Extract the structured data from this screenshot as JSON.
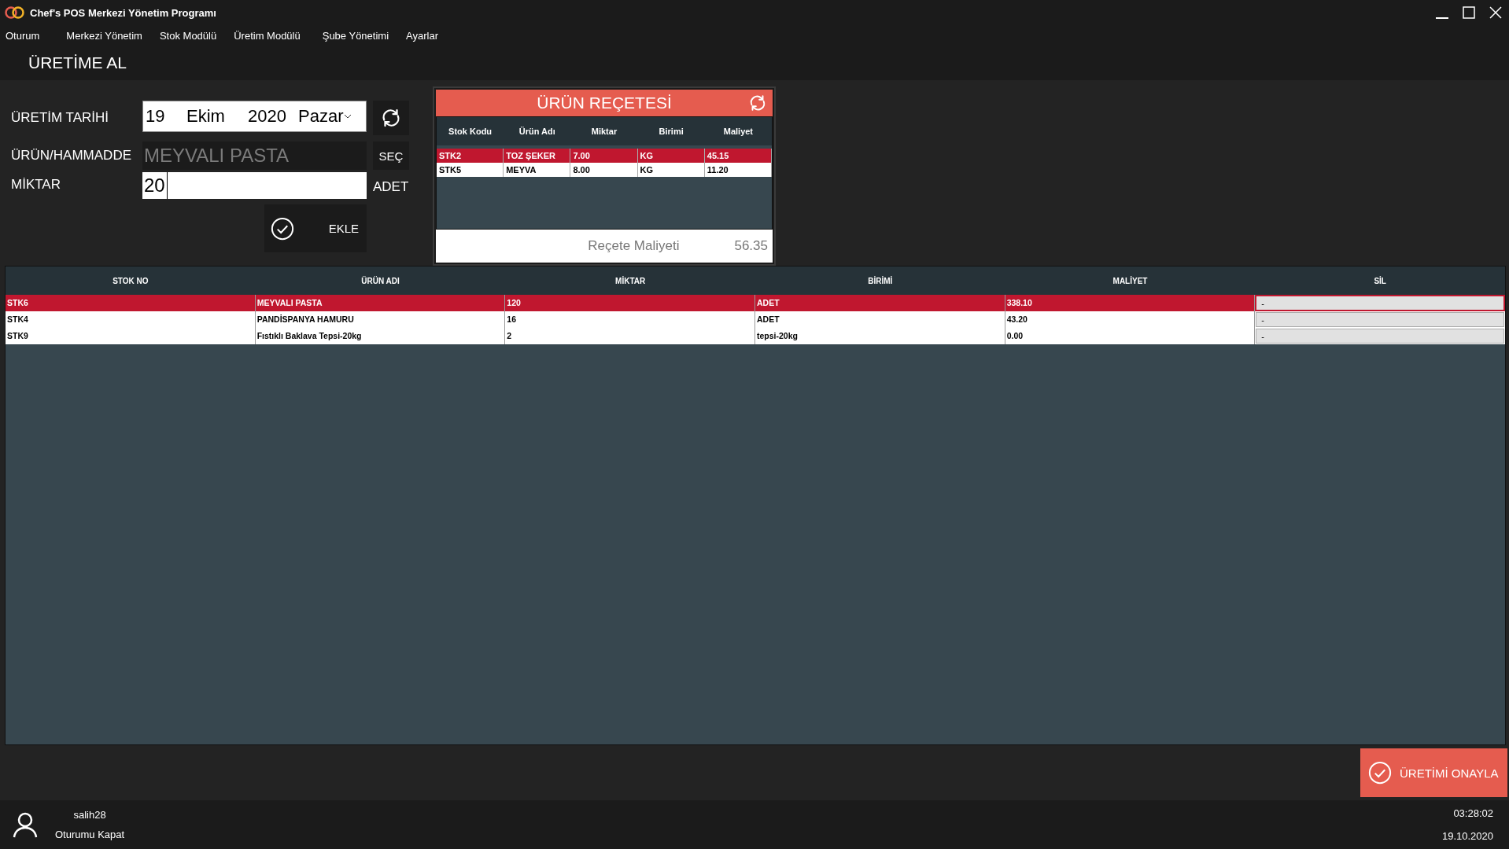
{
  "window": {
    "title": "Chef's POS Merkezi Yönetim Programı"
  },
  "menu": [
    "Oturum",
    "Merkezi Yönetim",
    "Stok Modülü",
    "Üretim Modülü",
    "Şube Yönetimi",
    "Ayarlar"
  ],
  "page_title": "ÜRETİME AL",
  "form": {
    "date_label": "ÜRETİM TARİHİ",
    "date": {
      "day": "19",
      "month": "Ekim",
      "year": "2020",
      "weekday": "Pazar"
    },
    "product_label": "ÜRÜN/HAMMADDE",
    "product_value": "MEYVALI PASTA",
    "select_button": "SEÇ",
    "quantity_label": "MİKTAR",
    "quantity_value": "20",
    "unit": "ADET",
    "add_button": "EKLE"
  },
  "recipe": {
    "title": "ÜRÜN REÇETESİ",
    "columns": [
      "Stok Kodu",
      "Ürün Adı",
      "Miktar",
      "Birimi",
      "Maliyet"
    ],
    "rows": [
      {
        "selected": true,
        "cells": [
          "STK2",
          "TOZ ŞEKER",
          "7.00",
          "KG",
          "45.15"
        ]
      },
      {
        "selected": false,
        "cells": [
          "STK5",
          "MEYVA",
          "8.00",
          "KG",
          "11.20"
        ]
      }
    ],
    "total_label": "Reçete Maliyeti",
    "total_value": "56.35"
  },
  "table": {
    "columns": [
      "STOK NO",
      "ÜRÜN ADI",
      "MİKTAR",
      "BİRİMİ",
      "MALİYET",
      "SİL"
    ],
    "rows": [
      {
        "selected": true,
        "cells": [
          "STK6",
          "MEYVALI PASTA",
          "120",
          "ADET",
          "338.10"
        ],
        "delete": "-"
      },
      {
        "selected": false,
        "cells": [
          "STK4",
          "PANDİSPANYA HAMURU",
          "16",
          "ADET",
          "43.20"
        ],
        "delete": "-"
      },
      {
        "selected": false,
        "cells": [
          "STK9",
          "Fıstıklı Baklava Tepsi-20kg",
          "2",
          "tepsi-20kg",
          "0.00"
        ],
        "delete": "-"
      }
    ]
  },
  "confirm_button": "ÜRETİMİ ONAYLA",
  "status_bar": {
    "user": "salih28",
    "logout": "Oturumu Kapat",
    "time": "03:28:02",
    "date": "19.10.2020"
  }
}
